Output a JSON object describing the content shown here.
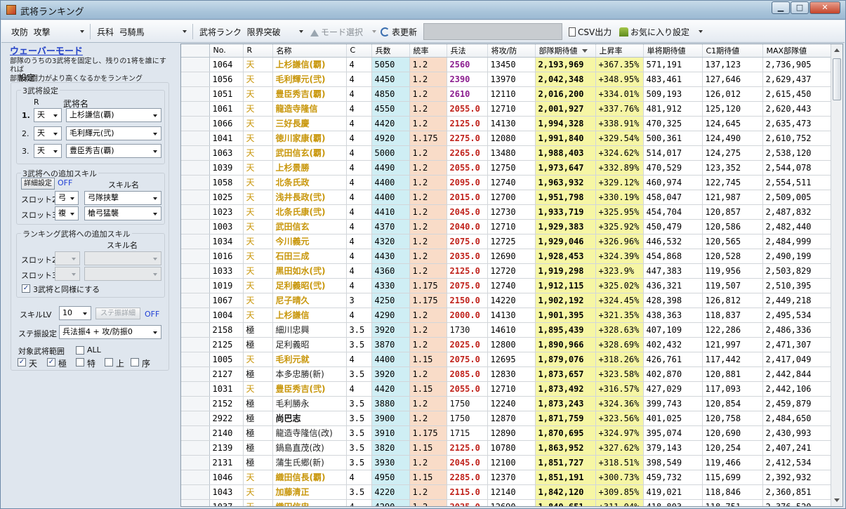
{
  "window": {
    "title": "武将ランキング"
  },
  "toolbar": {
    "mode_label": "攻防",
    "mode_value": "攻撃",
    "heika_label": "兵科",
    "heika_value": "弓騎馬",
    "rank_label": "武将ランク",
    "rank_value": "限界突破",
    "mode_select": "モード選択",
    "refresh": "表更新",
    "csv": "CSV出力",
    "favorites": "お気に入り設定"
  },
  "sidebar": {
    "title": "ウェーバーモード",
    "desc1": "部隊のうちの3武将を固定し、残りの1将を誰にすれば",
    "desc2": "部隊戦闘力がより高くなるかをランキング",
    "settings": "設定",
    "three_settings": "3武将設定",
    "col_r": "R",
    "col_name": "武将名",
    "generals": [
      {
        "num": "1.",
        "r": "天",
        "name": "上杉謙信(覇)"
      },
      {
        "num": "2.",
        "r": "天",
        "name": "毛利輝元(弐)"
      },
      {
        "num": "3.",
        "r": "天",
        "name": "豊臣秀吉(覇)"
      }
    ],
    "skill3_title": "3武将への追加スキル",
    "detail_btn": "詳細設定",
    "off1": "OFF",
    "skill_name_hdr": "スキル名",
    "slot2": "スロット2",
    "slot2_type": "弓",
    "slot2_skill": "弓隊挟撃",
    "slot3": "スロット3",
    "slot3_type": "複",
    "slot3_skill": "槍弓猛襲",
    "rank_skill_title": "ランキング武将への追加スキル",
    "rank_skill_name_hdr": "スキル名",
    "rslot2": "スロット2",
    "rslot3": "スロット3",
    "same_as": "3武将と同様にする",
    "same_check": "✓",
    "skill_lv_label": "スキルLV",
    "skill_lv": "10",
    "stat_detail_btn": "ステ振詳細",
    "off2": "OFF",
    "stat_label": "ステ振設定",
    "stat_value": "兵法振4 + 攻/防振0",
    "target_label": "対象武将範囲",
    "all_label": "ALL",
    "ranges": [
      {
        "label": "天",
        "checked": "✓"
      },
      {
        "label": "極",
        "checked": "✓"
      },
      {
        "label": "特",
        "checked": ""
      },
      {
        "label": "上",
        "checked": ""
      },
      {
        "label": "序",
        "checked": ""
      }
    ]
  },
  "grid": {
    "headers": [
      "No.",
      "R",
      "名称",
      "C",
      "兵数",
      "統率",
      "兵法",
      "将攻/防",
      "部隊期待値",
      "上昇率",
      "単将期待値",
      "C1期待値",
      "MAX部隊値"
    ],
    "rows": [
      [
        "1064",
        "天",
        "上杉謙信(覇)",
        "4",
        "5050",
        "1.2",
        "2560",
        "13450",
        "2,193,969",
        "+367.35%",
        "571,191",
        "137,123",
        "2,736,905",
        "gold",
        "purple"
      ],
      [
        "1056",
        "天",
        "毛利輝元(弐)",
        "4",
        "4450",
        "1.2",
        "2390",
        "13970",
        "2,042,348",
        "+348.95%",
        "483,461",
        "127,646",
        "2,629,437",
        "gold",
        "purple"
      ],
      [
        "1051",
        "天",
        "豊臣秀吉(覇)",
        "4",
        "4850",
        "1.2",
        "2610",
        "12110",
        "2,016,200",
        "+334.01%",
        "509,193",
        "126,012",
        "2,615,450",
        "gold",
        "purple"
      ],
      [
        "1061",
        "天",
        "龍造寺隆信",
        "4",
        "4550",
        "1.2",
        "2055.0",
        "12710",
        "2,001,927",
        "+337.76%",
        "481,912",
        "125,120",
        "2,620,443",
        "gold",
        "red"
      ],
      [
        "1066",
        "天",
        "三好長慶",
        "4",
        "4420",
        "1.2",
        "2125.0",
        "14130",
        "1,994,328",
        "+338.91%",
        "470,325",
        "124,645",
        "2,635,473",
        "gold",
        "red"
      ],
      [
        "1041",
        "天",
        "徳川家康(覇)",
        "4",
        "4920",
        "1.175",
        "2275.0",
        "12080",
        "1,991,840",
        "+329.54%",
        "500,361",
        "124,490",
        "2,610,752",
        "gold",
        "red"
      ],
      [
        "1063",
        "天",
        "武田信玄(覇)",
        "4",
        "5000",
        "1.2",
        "2265.0",
        "13480",
        "1,988,403",
        "+324.62%",
        "514,017",
        "124,275",
        "2,538,120",
        "gold",
        "red"
      ],
      [
        "1039",
        "天",
        "上杉景勝",
        "4",
        "4490",
        "1.2",
        "2055.0",
        "12750",
        "1,973,647",
        "+332.89%",
        "470,529",
        "123,352",
        "2,544,078",
        "gold",
        "red"
      ],
      [
        "1058",
        "天",
        "北条氏政",
        "4",
        "4400",
        "1.2",
        "2095.0",
        "12740",
        "1,963,932",
        "+329.12%",
        "460,974",
        "122,745",
        "2,554,511",
        "gold",
        "red"
      ],
      [
        "1025",
        "天",
        "浅井長政(弐)",
        "4",
        "4400",
        "1.2",
        "2015.0",
        "12700",
        "1,951,798",
        "+330.19%",
        "458,047",
        "121,987",
        "2,509,005",
        "gold",
        "red"
      ],
      [
        "1023",
        "天",
        "北条氏康(弐)",
        "4",
        "4410",
        "1.2",
        "2045.0",
        "12730",
        "1,933,719",
        "+325.95%",
        "454,704",
        "120,857",
        "2,487,832",
        "gold",
        "red"
      ],
      [
        "1003",
        "天",
        "武田信玄",
        "4",
        "4370",
        "1.2",
        "2040.0",
        "12710",
        "1,929,383",
        "+325.92%",
        "450,479",
        "120,586",
        "2,482,440",
        "gold",
        "red"
      ],
      [
        "1034",
        "天",
        "今川義元",
        "4",
        "4320",
        "1.2",
        "2075.0",
        "12725",
        "1,929,046",
        "+326.96%",
        "446,532",
        "120,565",
        "2,484,999",
        "gold",
        "red"
      ],
      [
        "1016",
        "天",
        "石田三成",
        "4",
        "4430",
        "1.2",
        "2035.0",
        "12690",
        "1,928,453",
        "+324.39%",
        "454,868",
        "120,528",
        "2,490,199",
        "gold",
        "red"
      ],
      [
        "1033",
        "天",
        "黒田如水(弐)",
        "4",
        "4360",
        "1.2",
        "2125.0",
        "12720",
        "1,919,298",
        "+323.9%",
        "447,383",
        "119,956",
        "2,503,829",
        "gold",
        "red"
      ],
      [
        "1019",
        "天",
        "足利義昭(弐)",
        "4",
        "4330",
        "1.175",
        "2075.0",
        "12740",
        "1,912,115",
        "+325.02%",
        "436,321",
        "119,507",
        "2,510,395",
        "gold",
        "red"
      ],
      [
        "1067",
        "天",
        "尼子晴久",
        "3",
        "4250",
        "1.175",
        "2150.0",
        "14220",
        "1,902,192",
        "+324.45%",
        "428,398",
        "126,812",
        "2,449,218",
        "gold",
        "red"
      ],
      [
        "1004",
        "天",
        "上杉謙信",
        "4",
        "4290",
        "1.2",
        "2000.0",
        "14130",
        "1,901,395",
        "+321.35%",
        "438,363",
        "118,837",
        "2,495,534",
        "gold",
        "red"
      ],
      [
        "2158",
        "極",
        "細川忠興",
        "3.5",
        "3920",
        "1.2",
        "1730",
        "14610",
        "1,895,439",
        "+328.63%",
        "407,109",
        "122,286",
        "2,486,336",
        "black",
        "black"
      ],
      [
        "2125",
        "極",
        "足利義昭",
        "3.5",
        "3870",
        "1.2",
        "2025.0",
        "12800",
        "1,890,966",
        "+328.69%",
        "402,432",
        "121,997",
        "2,471,307",
        "black",
        "red"
      ],
      [
        "1005",
        "天",
        "毛利元就",
        "4",
        "4400",
        "1.15",
        "2075.0",
        "12695",
        "1,879,076",
        "+318.26%",
        "426,761",
        "117,442",
        "2,417,049",
        "gold",
        "red"
      ],
      [
        "2127",
        "極",
        "本多忠勝(新)",
        "3.5",
        "3920",
        "1.2",
        "2085.0",
        "12830",
        "1,873,657",
        "+323.58%",
        "402,870",
        "120,881",
        "2,442,844",
        "black",
        "red"
      ],
      [
        "1031",
        "天",
        "豊臣秀吉(弐)",
        "4",
        "4420",
        "1.15",
        "2055.0",
        "12710",
        "1,873,492",
        "+316.57%",
        "427,029",
        "117,093",
        "2,442,106",
        "gold",
        "red"
      ],
      [
        "2152",
        "極",
        "毛利勝永",
        "3.5",
        "3880",
        "1.2",
        "1750",
        "12240",
        "1,873,243",
        "+324.36%",
        "399,743",
        "120,854",
        "2,459,879",
        "black",
        "black"
      ],
      [
        "2922",
        "極",
        "尚巴志",
        "3.5",
        "3900",
        "1.2",
        "1750",
        "12870",
        "1,871,759",
        "+323.56%",
        "401,025",
        "120,758",
        "2,484,650",
        "bold",
        "black"
      ],
      [
        "2140",
        "極",
        "龍造寺隆信(改)",
        "3.5",
        "3910",
        "1.175",
        "1715",
        "12890",
        "1,870,695",
        "+324.97%",
        "395,074",
        "120,690",
        "2,430,993",
        "black",
        "black"
      ],
      [
        "2139",
        "極",
        "鍋島直茂(改)",
        "3.5",
        "3820",
        "1.15",
        "2125.0",
        "10780",
        "1,863,952",
        "+327.62%",
        "379,143",
        "120,254",
        "2,407,241",
        "black",
        "red"
      ],
      [
        "2131",
        "極",
        "蒲生氏郷(新)",
        "3.5",
        "3930",
        "1.2",
        "2045.0",
        "12100",
        "1,851,727",
        "+318.51%",
        "398,549",
        "119,466",
        "2,412,534",
        "black",
        "red"
      ],
      [
        "1046",
        "天",
        "織田信長(覇)",
        "4",
        "4950",
        "1.15",
        "2285.0",
        "12370",
        "1,851,191",
        "+300.73%",
        "459,732",
        "115,699",
        "2,392,932",
        "gold",
        "red"
      ],
      [
        "1043",
        "天",
        "加藤清正",
        "3.5",
        "4220",
        "1.2",
        "2115.0",
        "12140",
        "1,842,120",
        "+309.85%",
        "419,021",
        "118,846",
        "2,360,851",
        "gold",
        "red"
      ],
      [
        "1037",
        "天",
        "織田信忠",
        "4",
        "4290",
        "1.2",
        "2025.0",
        "12690",
        "1,840,651",
        "+311.04%",
        "418,803",
        "118,751",
        "2,376,520",
        "gold",
        "red"
      ]
    ]
  }
}
